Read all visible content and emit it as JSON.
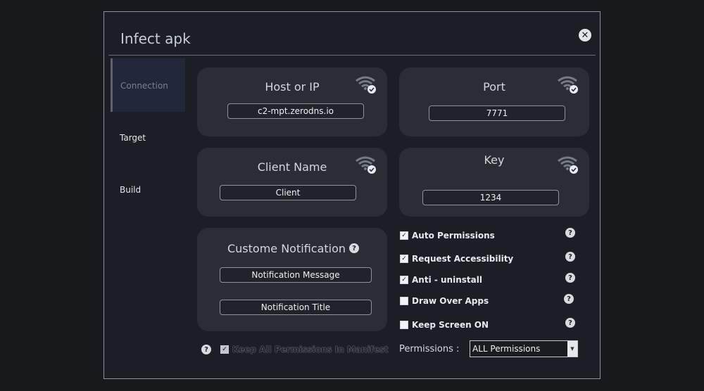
{
  "window": {
    "title": "Infect apk"
  },
  "nav": {
    "items": [
      {
        "label": "Connection"
      },
      {
        "label": "Target"
      },
      {
        "label": "Build"
      }
    ]
  },
  "cards": {
    "host": {
      "title": "Host or IP",
      "value": "c2-mpt.zerodns.io"
    },
    "port": {
      "title": "Port",
      "value": "7771"
    },
    "client": {
      "title": "Client Name",
      "value": "Client"
    },
    "key": {
      "title": "Key",
      "value": "1234"
    },
    "notification": {
      "title": "Custome Notification",
      "message": "Notification Message",
      "notif_title": "Notification Title"
    }
  },
  "options": [
    {
      "label": "Auto Permissions",
      "checked": true
    },
    {
      "label": "Request Accessibility",
      "checked": true
    },
    {
      "label": "Anti - uninstall",
      "checked": true
    },
    {
      "label": "Draw Over Apps",
      "checked": false
    },
    {
      "label": "Keep Screen ON",
      "checked": false
    }
  ],
  "keep_permissions": {
    "label": "Keep All Permissions In Manifest",
    "checked": true
  },
  "permissions": {
    "label": "Permissions :",
    "value": "ALL Permissions"
  },
  "icons": {
    "close": "close-icon",
    "wifi": "wifi-check-icon",
    "help": "help-icon",
    "dropdown": "chevron-down-icon"
  }
}
